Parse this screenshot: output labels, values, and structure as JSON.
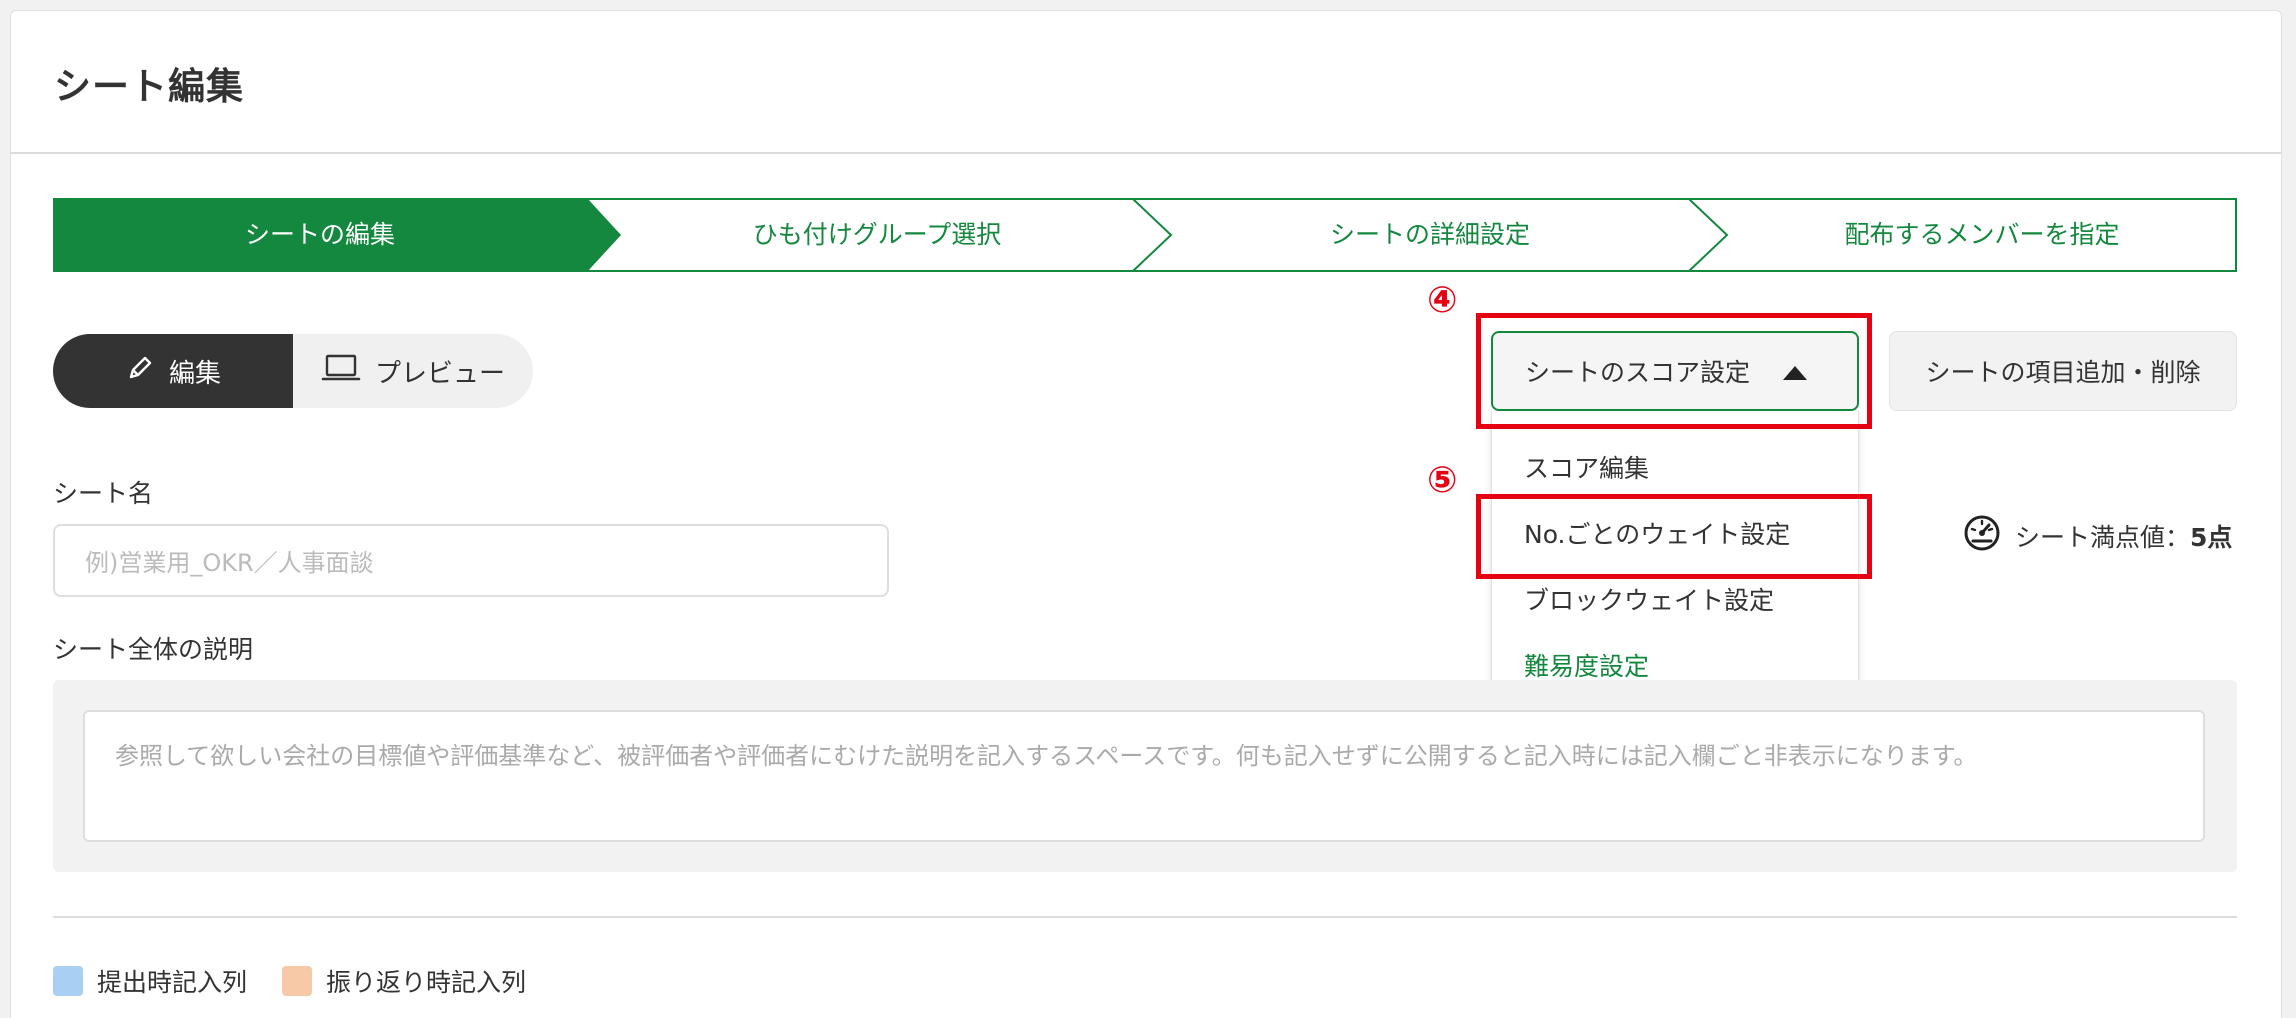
{
  "page": {
    "title": "シート編集"
  },
  "stepper": {
    "steps": [
      {
        "label": "シートの編集",
        "active": true
      },
      {
        "label": "ひも付けグループ選択",
        "active": false
      },
      {
        "label": "シートの詳細設定",
        "active": false
      },
      {
        "label": "配布するメンバーを指定",
        "active": false
      }
    ]
  },
  "mode_toggle": {
    "edit_label": "編集",
    "preview_label": "プレビュー",
    "selected": "編集"
  },
  "score_settings": {
    "button_label": "シートのスコア設定",
    "items": [
      "スコア編集",
      "No.ごとのウェイト設定",
      "ブロックウェイト設定",
      "難易度設定"
    ]
  },
  "add_item_button_label": "シートの項目追加・削除",
  "annotations": {
    "four": "④",
    "five": "⑤"
  },
  "form": {
    "sheet_name_label": "シート名",
    "sheet_name_placeholder": "例)営業用_OKR／人事面談",
    "max_score_label": "シート満点値：",
    "max_score_value": "5点",
    "description_label": "シート全体の説明",
    "description_placeholder": "参照して欲しい会社の目標値や評価基準など、被評価者や評価者にむけた説明を記入するスペースです。何も記入せずに公開すると記入時には記入欄ごと非表示になります。"
  },
  "legend": [
    {
      "label": "提出時記入列",
      "color": "#a9cff3"
    },
    {
      "label": "振り返り時記入列",
      "color": "#f7c9a6"
    }
  ],
  "colors": {
    "accent": "#14883f",
    "annotation": "#e60012"
  }
}
